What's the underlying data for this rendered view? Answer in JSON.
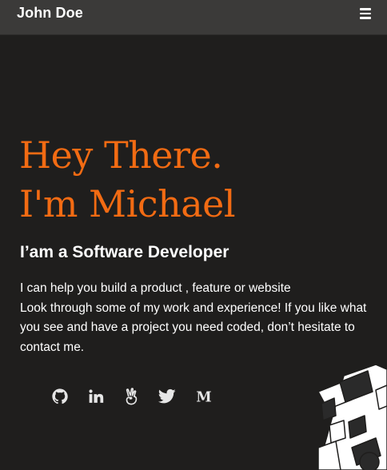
{
  "navbar": {
    "brand": "John Doe",
    "menu_icon": "hamburger-menu-icon"
  },
  "hero": {
    "line1": "Hey There.",
    "line2": "I'm Michael",
    "accent_color": "#f26b13"
  },
  "subtitle": "I’am a Software Developer",
  "intro": {
    "line1": "I can help you build a product , feature or website",
    "rest": "Look through some of my work and experience! If you like what you see and have a project you need coded, don’t hesitate to contact me."
  },
  "socials": [
    {
      "icon": "github-icon"
    },
    {
      "icon": "linkedin-icon"
    },
    {
      "icon": "angellist-icon"
    },
    {
      "icon": "twitter-icon"
    },
    {
      "icon": "medium-icon"
    }
  ],
  "colors": {
    "background": "#1f1e1d",
    "navbar": "#3b3a39",
    "text": "#ffffff"
  }
}
